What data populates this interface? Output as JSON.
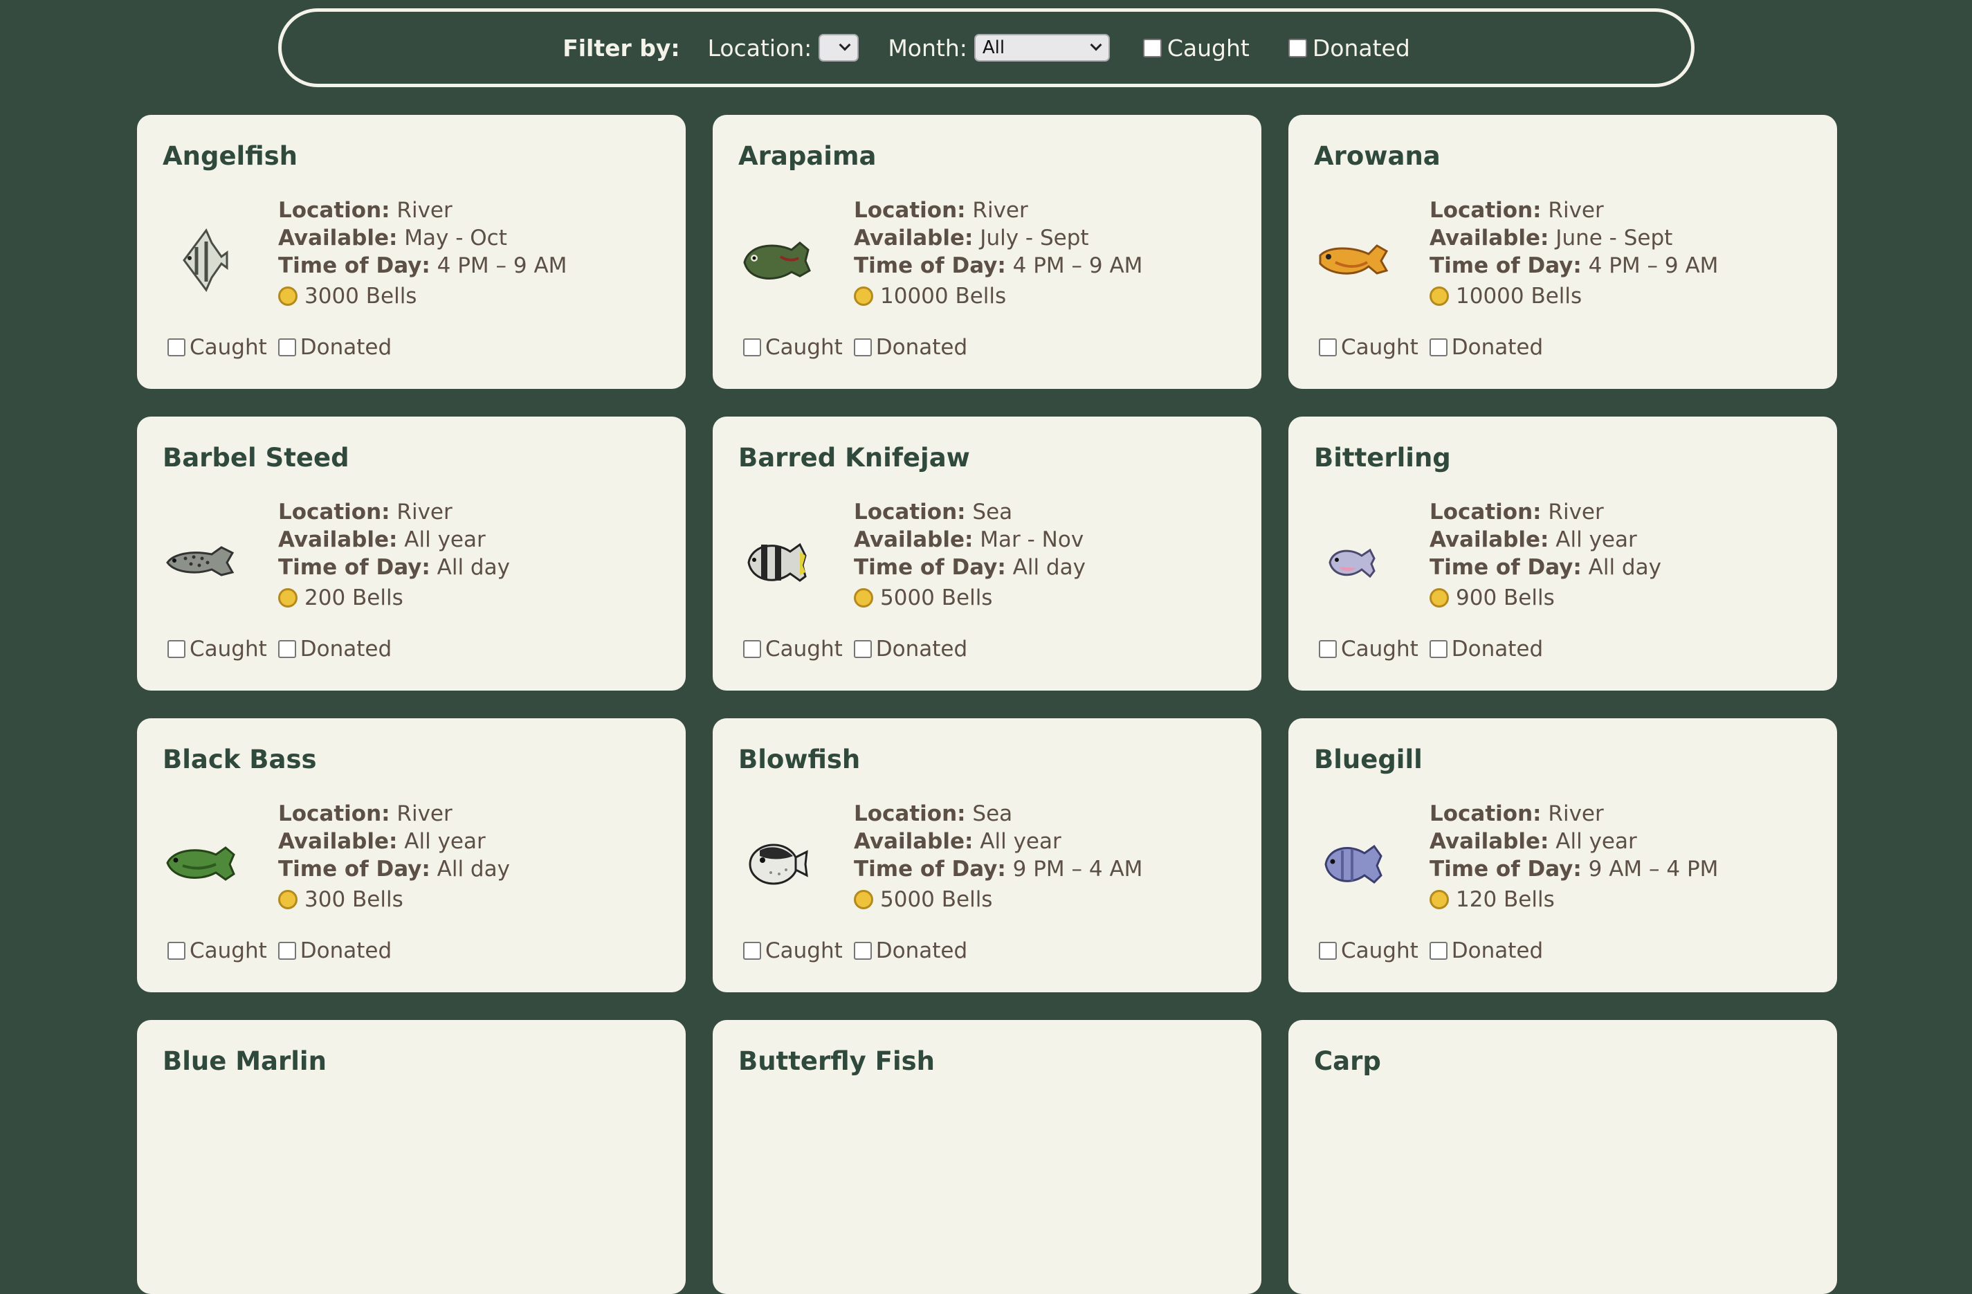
{
  "filter": {
    "title": "Filter by:",
    "location_label": "Location:",
    "location_value": "",
    "month_label": "Month:",
    "month_value": "All",
    "caught_label": "Caught",
    "donated_label": "Donated"
  },
  "labels": {
    "location": "Location:",
    "available": "Available:",
    "time": "Time of Day:",
    "caught": "Caught",
    "donated": "Donated"
  },
  "colors": {
    "background": "#364b40",
    "card": "#f4f3e9",
    "title": "#2f4a3c",
    "text": "#5c4f45",
    "coin": "#eec23a"
  },
  "fish": [
    {
      "name": "Angelfish",
      "location": "River",
      "available": "May - Oct",
      "time": "4 PM – 9 AM",
      "price": "3000 Bells",
      "icon": "angelfish-icon"
    },
    {
      "name": "Arapaima",
      "location": "River",
      "available": "July - Sept",
      "time": "4 PM – 9 AM",
      "price": "10000 Bells",
      "icon": "arapaima-icon"
    },
    {
      "name": "Arowana",
      "location": "River",
      "available": "June - Sept",
      "time": "4 PM – 9 AM",
      "price": "10000 Bells",
      "icon": "arowana-icon"
    },
    {
      "name": "Barbel Steed",
      "location": "River",
      "available": "All year",
      "time": "All day",
      "price": "200 Bells",
      "icon": "barbel-steed-icon"
    },
    {
      "name": "Barred Knifejaw",
      "location": "Sea",
      "available": "Mar - Nov",
      "time": "All day",
      "price": "5000 Bells",
      "icon": "barred-knifejaw-icon"
    },
    {
      "name": "Bitterling",
      "location": "River",
      "available": "All year",
      "time": "All day",
      "price": "900 Bells",
      "icon": "bitterling-icon"
    },
    {
      "name": "Black Bass",
      "location": "River",
      "available": "All year",
      "time": "All day",
      "price": "300 Bells",
      "icon": "black-bass-icon"
    },
    {
      "name": "Blowfish",
      "location": "Sea",
      "available": "All year",
      "time": "9 PM – 4 AM",
      "price": "5000 Bells",
      "icon": "blowfish-icon"
    },
    {
      "name": "Bluegill",
      "location": "River",
      "available": "All year",
      "time": "9 AM – 4 PM",
      "price": "120 Bells",
      "icon": "bluegill-icon"
    },
    {
      "name": "Blue Marlin"
    },
    {
      "name": "Butterfly Fish"
    },
    {
      "name": "Carp"
    }
  ]
}
